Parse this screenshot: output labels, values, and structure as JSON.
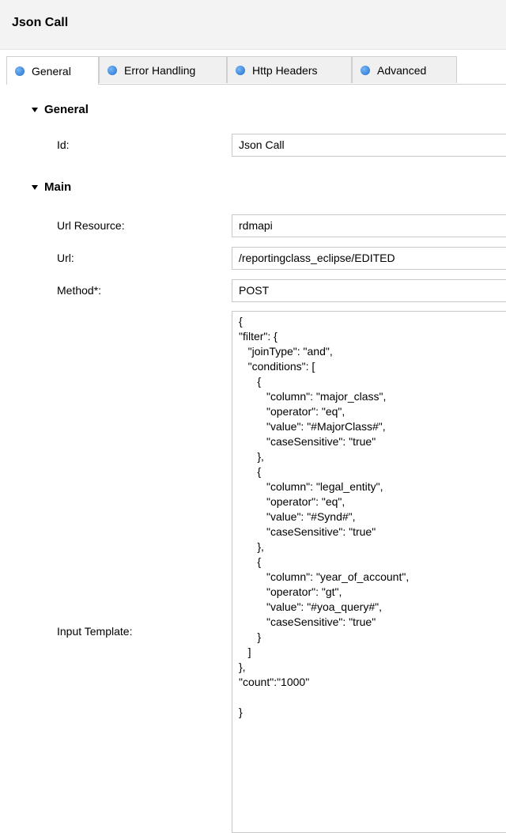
{
  "header": {
    "title": "Json Call"
  },
  "tabs": [
    {
      "label": "General"
    },
    {
      "label": "Error Handling"
    },
    {
      "label": "Http Headers"
    },
    {
      "label": "Advanced"
    }
  ],
  "sections": {
    "general": {
      "title": "General",
      "id_label": "Id:",
      "id_value": "Json Call"
    },
    "main": {
      "title": "Main",
      "url_resource_label": "Url Resource:",
      "url_resource_value": "rdmapi",
      "url_label": "Url:",
      "url_value": "/reportingclass_eclipse/EDITED",
      "method_label": "Method*:",
      "method_value": "POST",
      "input_template_label": "Input Template:",
      "input_template_value": "{\n\"filter\": {\n   \"joinType\": \"and\",\n   \"conditions\": [\n      {\n         \"column\": \"major_class\",\n         \"operator\": \"eq\",\n         \"value\": \"#MajorClass#\",\n         \"caseSensitive\": \"true\"\n      },\n      {\n         \"column\": \"legal_entity\",\n         \"operator\": \"eq\",\n         \"value\": \"#Synd#\",\n         \"caseSensitive\": \"true\"\n      },\n      {\n         \"column\": \"year_of_account\",\n         \"operator\": \"gt\",\n         \"value\": \"#yoa_query#\",\n         \"caseSensitive\": \"true\"\n      }\n   ]\n},\n\"count\":\"1000\"\n\n}"
    }
  },
  "colors": {
    "tab_dot": "#1f6fd0",
    "title_bar": "#f3f3f3"
  }
}
